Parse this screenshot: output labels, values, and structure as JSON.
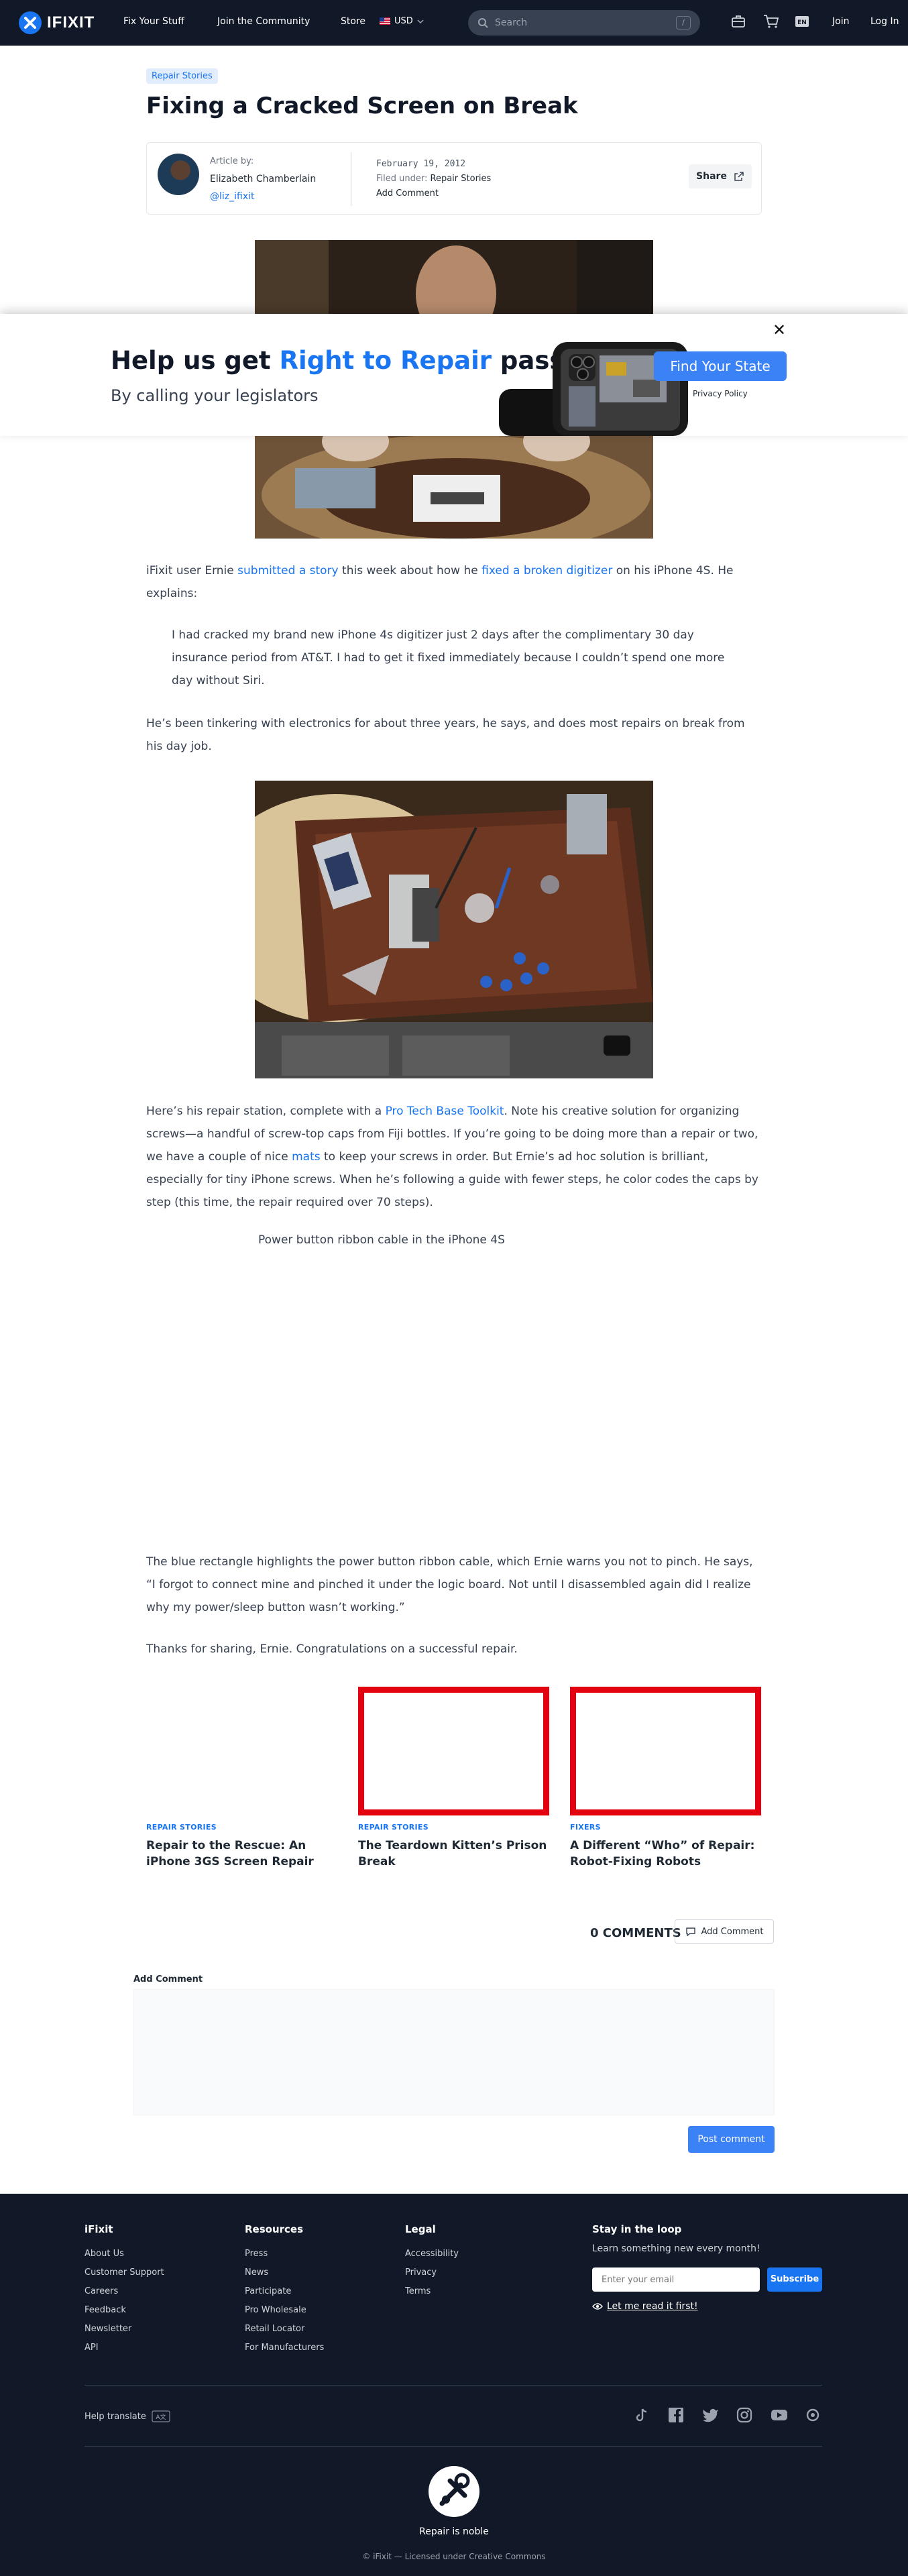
{
  "header": {
    "logo_text": "IFIXIT",
    "nav": [
      "Fix Your Stuff",
      "Join the Community",
      "Store"
    ],
    "currency": "USD",
    "search_placeholder": "Search",
    "search_shortcut": "/",
    "lang_badge": "EN",
    "join": "Join",
    "login": "Log In"
  },
  "article": {
    "tag": "Repair Stories",
    "title": "Fixing a Cracked Screen on Break",
    "byline": {
      "label": "Article by:",
      "author": "Elizabeth Chamberlain",
      "handle": "@liz_ifixit",
      "date": "February 19, 2012",
      "filed_label": "Filed under:",
      "filed_value": "Repair Stories",
      "add_comment": "Add Comment",
      "share": "Share"
    },
    "p1": {
      "pre": "iFixit user Ernie ",
      "link1": "submitted a story",
      "mid": " this week about how he ",
      "link2": "fixed a broken digitizer",
      "post": " on his iPhone 4S. He explains:"
    },
    "quote": "I had cracked my brand new iPhone 4s digitizer just 2 days after the complimentary 30 day insurance period from AT&T. I had to get it fixed immediately because I couldn’t spend one more day without Siri.",
    "p2": "He’s been tinkering with electronics for about three years, he says, and does most repairs on break from his day job.",
    "p3": {
      "pre": "Here’s his repair station, complete with a ",
      "link1": "Pro Tech Base Toolkit",
      "mid1": ". Note his creative solution for organizing screws—a handful of screw-top caps from Fiji bottles. If you’re going to be doing more than a repair or two, we have a couple of nice ",
      "link2": "mats",
      "post": " to keep your screws in order. But Ernie’s ad hoc solution is brilliant, especially for tiny iPhone screws. When he’s following a guide with fewer steps, he color codes the caps by step (this time, the repair required over 70 steps)."
    },
    "caption": "Power button ribbon cable in the iPhone 4S",
    "p4": "The blue rectangle highlights the power button ribbon cable, which Ernie warns you not to pinch. He says, “I forgot to connect mine and pinched it under the logic board. Not until I disassembled again did I realize why my power/sleep button wasn’t working.”",
    "p5": "Thanks for sharing, Ernie. Congratulations on a successful repair."
  },
  "banner": {
    "headline_pre": "Help us get ",
    "headline_highlight": "Right to Repair",
    "headline_post": " passed",
    "subhead": "By calling your legislators",
    "button": "Find Your State",
    "privacy": "Privacy Policy",
    "close": "✕"
  },
  "related": [
    {
      "tag": "REPAIR STORIES",
      "title": "Repair to the Rescue: An iPhone 3GS Screen Repair"
    },
    {
      "tag": "REPAIR STORIES",
      "title": "The Teardown Kitten’s Prison Break"
    },
    {
      "tag": "FIXERS",
      "title": "A Different “Who” of Repair: Robot-Fixing Robots"
    }
  ],
  "comments": {
    "count": "0 COMMENTS",
    "add_button": "Add Comment",
    "label": "Add Comment",
    "post_button": "Post comment"
  },
  "footer": {
    "col_ifixit": {
      "title": "iFixit",
      "links": [
        "About Us",
        "Customer Support",
        "Careers",
        "Feedback",
        "Newsletter",
        "API"
      ]
    },
    "col_resources": {
      "title": "Resources",
      "links": [
        "Press",
        "News",
        "Participate",
        "Pro Wholesale",
        "Retail Locator",
        "For Manufacturers"
      ]
    },
    "col_legal": {
      "title": "Legal",
      "links": [
        "Accessibility",
        "Privacy",
        "Terms"
      ]
    },
    "newsletter": {
      "title": "Stay in the loop",
      "subtitle": "Learn something new every month!",
      "placeholder": "Enter your email",
      "button": "Subscribe",
      "read_link": "Let me read it first!"
    },
    "help_translate": "Help translate",
    "social_icons": [
      "tiktok-icon",
      "facebook-icon",
      "twitter-icon",
      "instagram-icon",
      "youtube-icon",
      "community-icon"
    ],
    "tagline": "Repair is noble",
    "license": "© iFixit — Licensed under Creative Commons"
  },
  "colors": {
    "accent": "#1975f1",
    "dark": "#111827",
    "related_border": "#e3000f"
  }
}
